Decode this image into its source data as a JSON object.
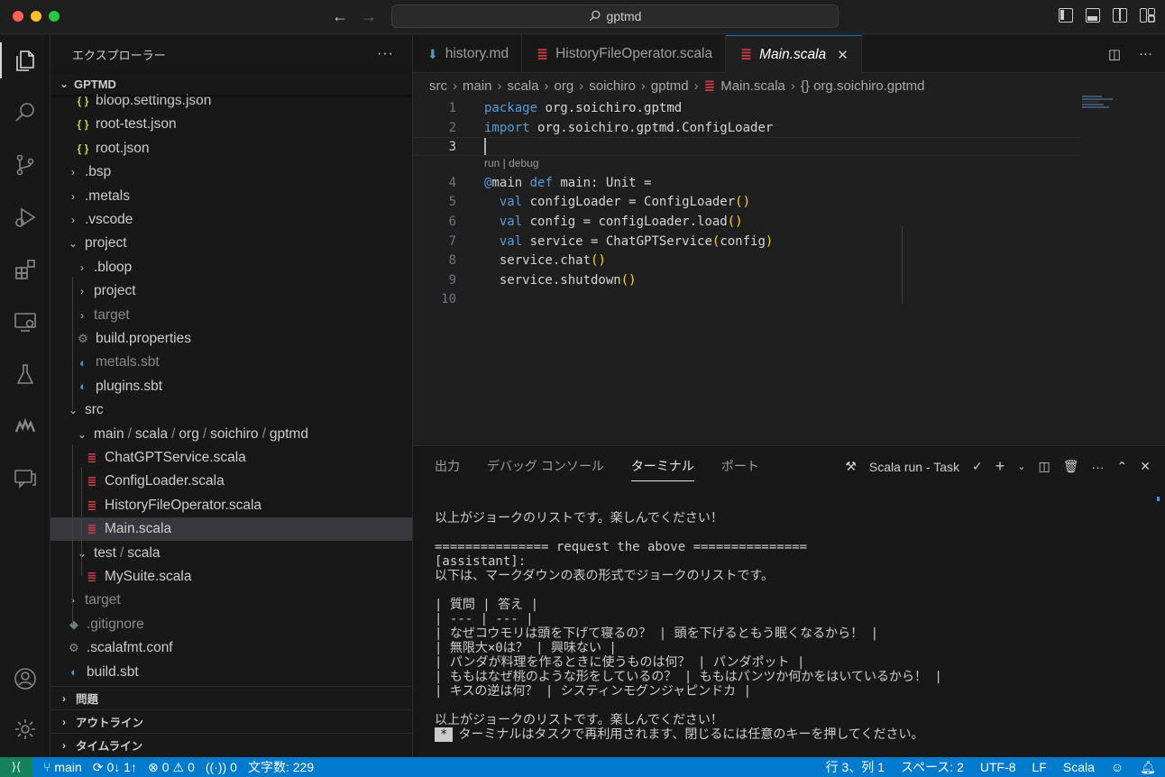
{
  "titlebar": {
    "search_text": "gptmd",
    "back": "←",
    "forward": "→"
  },
  "sidebar": {
    "title": "エクスプローラー",
    "more": "···",
    "folder": "GPTMD",
    "tree": [
      {
        "label": "bloop.settings.json",
        "icon": "json",
        "indent": 2,
        "chev": ""
      },
      {
        "label": "root-test.json",
        "icon": "json",
        "indent": 2,
        "chev": ""
      },
      {
        "label": "root.json",
        "icon": "json",
        "indent": 2,
        "chev": ""
      },
      {
        "label": ".bsp",
        "icon": "",
        "indent": 1,
        "chev": "›"
      },
      {
        "label": ".metals",
        "icon": "",
        "indent": 1,
        "chev": "›"
      },
      {
        "label": ".vscode",
        "icon": "",
        "indent": 1,
        "chev": "›"
      },
      {
        "label": "project",
        "icon": "",
        "indent": 1,
        "chev": "⌄"
      },
      {
        "label": ".bloop",
        "icon": "",
        "indent": 2,
        "chev": "›"
      },
      {
        "label": "project",
        "icon": "",
        "indent": 2,
        "chev": "›"
      },
      {
        "label": "target",
        "icon": "",
        "indent": 2,
        "chev": "›",
        "muted": true
      },
      {
        "label": "build.properties",
        "icon": "gear",
        "indent": 2,
        "chev": ""
      },
      {
        "label": "metals.sbt",
        "icon": "sbt",
        "indent": 2,
        "chev": "",
        "muted": true
      },
      {
        "label": "plugins.sbt",
        "icon": "sbt",
        "indent": 2,
        "chev": ""
      },
      {
        "label": "src",
        "icon": "",
        "indent": 1,
        "chev": "⌄"
      },
      {
        "label": "main / scala / org / soichiro / gptmd",
        "icon": "",
        "indent": 2,
        "chev": "⌄"
      },
      {
        "label": "ChatGPTService.scala",
        "icon": "scala",
        "indent": 3,
        "chev": ""
      },
      {
        "label": "ConfigLoader.scala",
        "icon": "scala",
        "indent": 3,
        "chev": ""
      },
      {
        "label": "HistoryFileOperator.scala",
        "icon": "scala",
        "indent": 3,
        "chev": ""
      },
      {
        "label": "Main.scala",
        "icon": "scala",
        "indent": 3,
        "chev": "",
        "selected": true
      },
      {
        "label": "test / scala",
        "icon": "",
        "indent": 2,
        "chev": "⌄"
      },
      {
        "label": "MySuite.scala",
        "icon": "scala",
        "indent": 3,
        "chev": ""
      },
      {
        "label": "target",
        "icon": "",
        "indent": 1,
        "chev": "›",
        "muted": true
      },
      {
        "label": ".gitignore",
        "icon": "git",
        "indent": 1,
        "chev": "",
        "muted": true
      },
      {
        "label": ".scalafmt.conf",
        "icon": "gear",
        "indent": 1,
        "chev": ""
      },
      {
        "label": "build.sbt",
        "icon": "sbt",
        "indent": 1,
        "chev": ""
      }
    ],
    "sections": [
      "問題",
      "アウトライン",
      "タイムライン"
    ]
  },
  "editor": {
    "tabs": [
      {
        "label": "history.md",
        "icon": "md"
      },
      {
        "label": "HistoryFileOperator.scala",
        "icon": "scala"
      },
      {
        "label": "Main.scala",
        "icon": "scala",
        "active": true,
        "close": "✕"
      }
    ],
    "breadcrumbs": [
      "src",
      "main",
      "scala",
      "org",
      "soichiro",
      "gptmd",
      "Main.scala",
      "{} org.soichiro.gptmd"
    ],
    "codelens": "run | debug",
    "line_numbers": [
      "1",
      "2",
      "3",
      "4",
      "5",
      "6",
      "7",
      "8",
      "9",
      "10"
    ],
    "current_line": 3
  },
  "panel": {
    "tabs": [
      "出力",
      "デバッグ コンソール",
      "ターミナル",
      "ポート"
    ],
    "active_tab": "ターミナル",
    "task_label": "Scala run - Task",
    "terminal_lines": [
      "以上がジョークのリストです。楽しんでください！",
      "",
      "=============== request the above ===============",
      "[assistant]:",
      "以下は、マークダウンの表の形式でジョークのリストです。",
      "",
      "| 質問 | 答え |",
      "| --- | --- |",
      "| なぜコウモリは頭を下げて寝るの？ | 頭を下げるともう眠くなるから！ |",
      "| 無限大×0は？ | 興味ない |",
      "| パンダが料理を作るときに使うものは何？ | パンダポット |",
      "| ももはなぜ桃のような形をしているの？ | ももはパンツか何かをはいているから！ |",
      "| キスの逆は何？ | システィンモグンジャピンドカ |",
      "",
      "以上がジョークのリストです。楽しんでください！"
    ],
    "terminal_last_star": "*",
    "terminal_last": "ターミナルはタスクで再利用されます、閉じるには任意のキーを押してください。"
  },
  "statusbar": {
    "remote": "⚡",
    "branch": "main",
    "sync": "0↓ 1↑",
    "errors": "0",
    "warnings": "0",
    "ports": "0",
    "char_count": "文字数: 229",
    "position": "行 3、列 1",
    "spaces": "スペース: 2",
    "encoding": "UTF-8",
    "eol": "LF",
    "language": "Scala"
  }
}
